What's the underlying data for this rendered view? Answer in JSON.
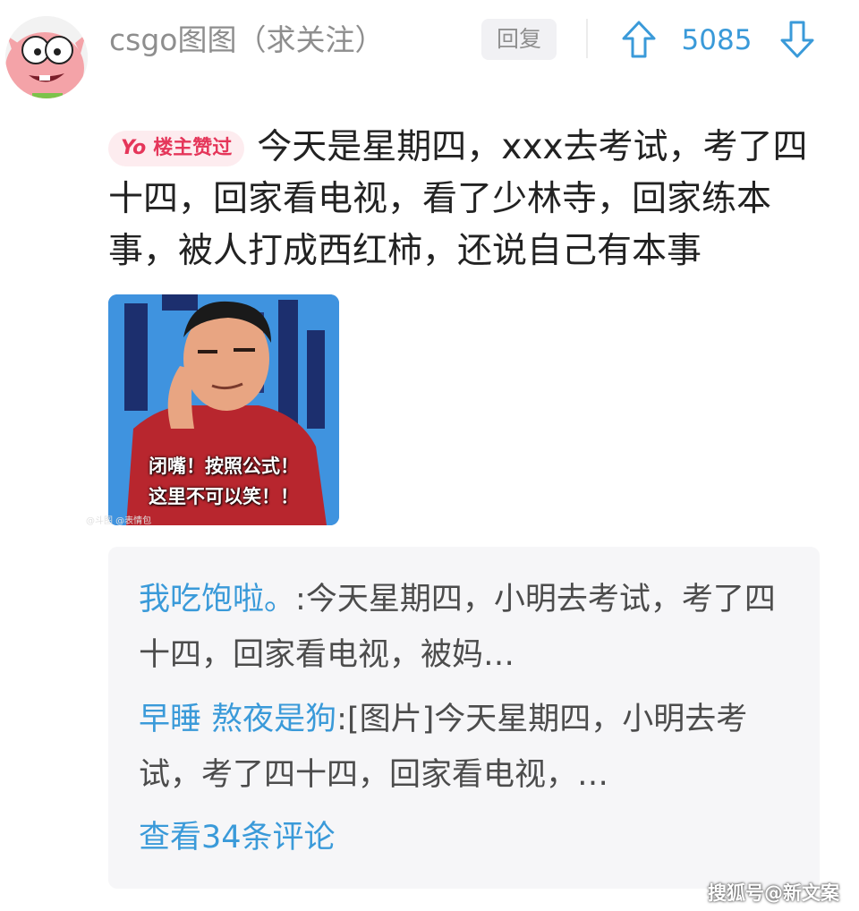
{
  "comment": {
    "username": "csgo图图（求关注）",
    "reply_label": "回复",
    "vote_count": "5085",
    "badge_yo": "Yo",
    "badge_label": "楼主赞过",
    "text": "今天是星期四，xxx去考试，考了四十四，回家看电视，看了少林寺，回家练本事，被人打成西红柿，还说自己有本事"
  },
  "meme": {
    "caption_line1": "闭嘴！按照公式！",
    "caption_line2": "这里不可以笑！！",
    "watermark": "@斗图 @表情包"
  },
  "replies": [
    {
      "name": "我吃饱啦。",
      "separator": ":",
      "text": "今天星期四，小明去考试，考了四十四，回家看电视，被妈…"
    },
    {
      "name": "早睡 熬夜是狗",
      "separator": ":",
      "text": "[图片]今天星期四，小明去考试，考了四十四，回家看电视，…"
    }
  ],
  "view_more": "查看34条评论",
  "source_watermark": "搜狐号@新文案",
  "colors": {
    "accent_blue": "#3a9ad9",
    "badge_pink": "#e5365a"
  },
  "icons": [
    "avatar",
    "upvote-arrow-icon",
    "downvote-arrow-icon"
  ]
}
